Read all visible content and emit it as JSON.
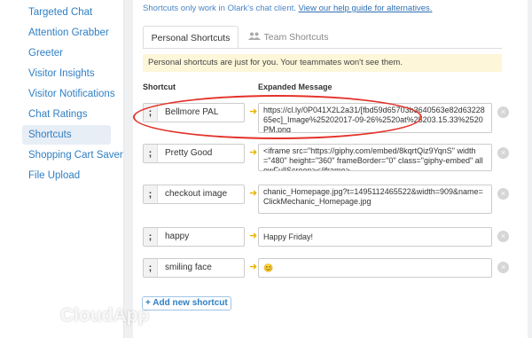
{
  "sidebar": {
    "items": [
      {
        "label": "Targeted Chat",
        "active": false
      },
      {
        "label": "Attention Grabber",
        "active": false
      },
      {
        "label": "Greeter",
        "active": false
      },
      {
        "label": "Visitor Insights",
        "active": false
      },
      {
        "label": "Visitor Notifications",
        "active": false
      },
      {
        "label": "Chat Ratings",
        "active": false
      },
      {
        "label": "Shortcuts",
        "active": true
      },
      {
        "label": "Shopping Cart Saver",
        "active": false
      },
      {
        "label": "File Upload",
        "active": false
      }
    ]
  },
  "notice": {
    "text": "Shortcuts only work in Olark's chat client. ",
    "link": "View our help guide for alternatives."
  },
  "tabs": {
    "personal": "Personal Shortcuts",
    "team": "Team Shortcuts"
  },
  "info": "Personal shortcuts are just for you. Your teammates won't see them.",
  "columns": {
    "shortcut": "Shortcut",
    "expanded": "Expanded Message"
  },
  "shortcuts": [
    {
      "key": "Bellmore PAL",
      "message": "https://cl.ly/0P041X2L2a31/[fbd59d65703b3640563e82d6322865ec]_Image%25202017-09-26%2520at%25203.15.33%2520PM.png"
    },
    {
      "key": "Pretty Good",
      "message": "<iframe src=\"https://giphy.com/embed/8kqrtQiz9YqnS\" width=\"480\" height=\"360\" frameBorder=\"0\" class=\"giphy-embed\" allowFullScreen></iframe>"
    },
    {
      "key": "checkout image",
      "message": "chanic_Homepage.jpg?t=1495112465522&width=909&name=ClickMechanic_Homepage.jpg"
    },
    {
      "key": "happy",
      "message": "Happy Friday!"
    },
    {
      "key": "smiling face",
      "message": "😊"
    }
  ],
  "add_button": "+ Add new shortcut",
  "semicolon": ";",
  "arrow": "➜",
  "delete": "×",
  "watermark": "CloudApp",
  "colors": {
    "accent": "#2f7fc4",
    "callout": "#e33229",
    "info_bg": "#fdf6d9"
  }
}
